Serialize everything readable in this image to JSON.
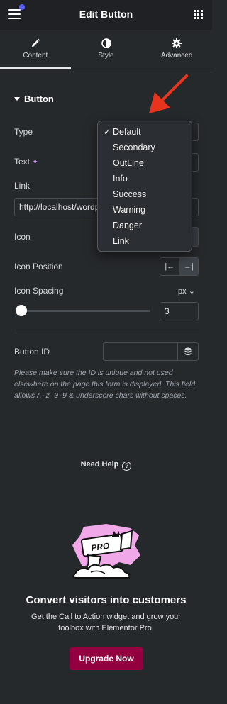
{
  "header": {
    "title": "Edit Button"
  },
  "tabs": [
    {
      "label": "Content",
      "icon": "pencil-icon"
    },
    {
      "label": "Style",
      "icon": "half-circle-icon"
    },
    {
      "label": "Advanced",
      "icon": "gear-icon"
    }
  ],
  "section": {
    "title": "Button"
  },
  "controls": {
    "type_label": "Type",
    "text_label": "Text",
    "link_label": "Link",
    "link_value": "http://localhost/wordp",
    "icon_label": "Icon",
    "icon_position_label": "Icon Position",
    "icon_spacing_label": "Icon Spacing",
    "icon_spacing_unit": "px",
    "icon_spacing_value": "3",
    "icon_spacing_level": 0,
    "button_id_label": "Button ID",
    "button_id_help_1": "Please make sure the ID is unique and not used elsewhere on the page this form is displayed. This field allows ",
    "button_id_help_code1": "A-z 0-9",
    "button_id_help_2": " & underscore chars without spaces."
  },
  "dropdown": {
    "selected_mark": "✓",
    "options": [
      "Default",
      "Secondary",
      "OutLine",
      "Info",
      "Success",
      "Warning",
      "Danger",
      "Link"
    ],
    "selected": "Default"
  },
  "help": {
    "label": "Need Help",
    "icon_glyph": "?"
  },
  "promo": {
    "badge": "PRO",
    "title": "Convert visitors into customers",
    "subtitle": "Get the Call to Action widget and grow your toolbox with Elementor Pro.",
    "button": "Upgrade Now"
  },
  "colors": {
    "panel_bg": "#26292c",
    "topbar_bg": "#1f2124",
    "accent_dot": "#5b5ef2",
    "upgrade_button": "#93003f",
    "arrow": "#e8341c",
    "promo_pink": "#f0a8e8"
  }
}
